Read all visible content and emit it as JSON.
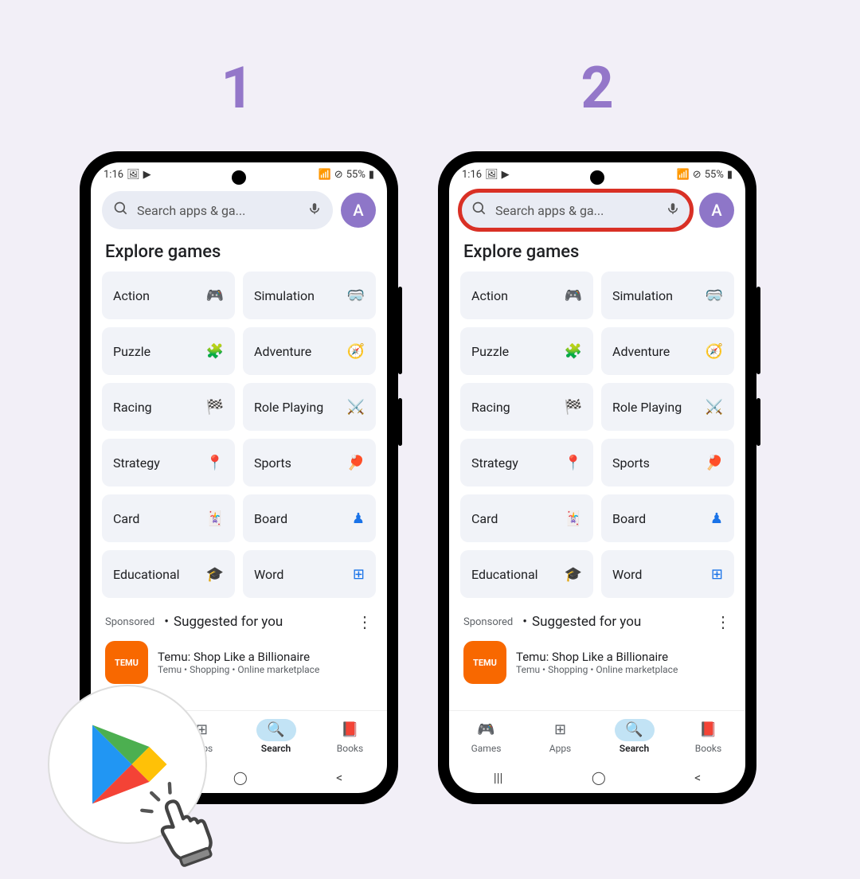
{
  "steps": {
    "s1": "1",
    "s2": "2"
  },
  "status": {
    "time": "1:16",
    "battery": "55%"
  },
  "search": {
    "placeholder": "Search apps & ga..."
  },
  "avatar": "A",
  "explore": "Explore games",
  "categories": [
    {
      "label": "Action"
    },
    {
      "label": "Simulation"
    },
    {
      "label": "Puzzle"
    },
    {
      "label": "Adventure"
    },
    {
      "label": "Racing"
    },
    {
      "label": "Role Playing"
    },
    {
      "label": "Strategy"
    },
    {
      "label": "Sports"
    },
    {
      "label": "Card"
    },
    {
      "label": "Board"
    },
    {
      "label": "Educational"
    },
    {
      "label": "Word"
    }
  ],
  "suggested": {
    "sponsored": "Sponsored",
    "title": "Suggested for you"
  },
  "app": {
    "icon_label": "TEMU",
    "name": "Temu: Shop Like a Billionaire",
    "meta": "Temu • Shopping • Online marketplace"
  },
  "nav": {
    "games": "Games",
    "apps": "Apps",
    "search": "Search",
    "books": "Books"
  }
}
